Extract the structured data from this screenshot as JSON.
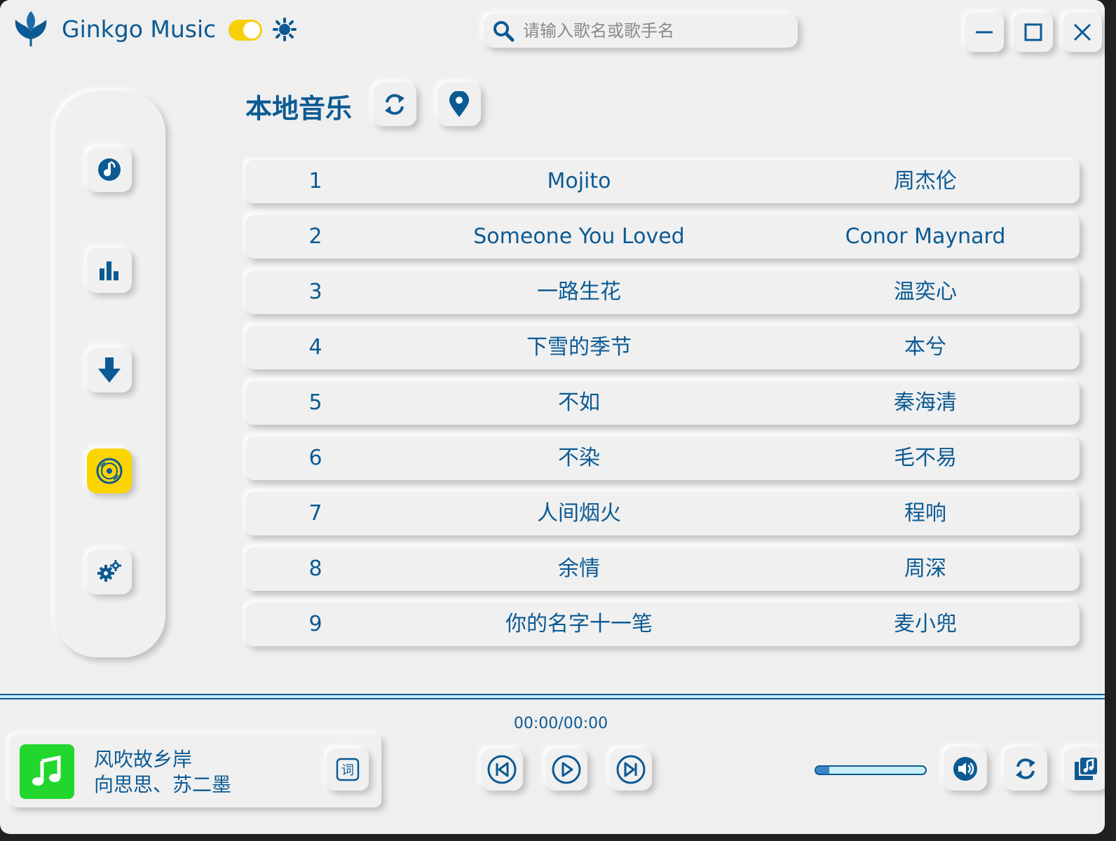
{
  "app": {
    "title": "Ginkgo Music"
  },
  "search": {
    "placeholder": "请输入歌名或歌手名"
  },
  "theme": {
    "toggle_on": true
  },
  "page": {
    "title": "本地音乐"
  },
  "songs": [
    {
      "index": "1",
      "title": "Mojito",
      "artist": "周杰伦"
    },
    {
      "index": "2",
      "title": "Someone You Loved",
      "artist": "Conor Maynard"
    },
    {
      "index": "3",
      "title": "一路生花",
      "artist": "温奕心"
    },
    {
      "index": "4",
      "title": "下雪的季节",
      "artist": "本兮"
    },
    {
      "index": "5",
      "title": "不如",
      "artist": "秦海清"
    },
    {
      "index": "6",
      "title": "不染",
      "artist": "毛不易"
    },
    {
      "index": "7",
      "title": "人间烟火",
      "artist": "程响"
    },
    {
      "index": "8",
      "title": "余情",
      "artist": "周深"
    },
    {
      "index": "9",
      "title": "你的名字十一笔",
      "artist": "麦小兜"
    }
  ],
  "player": {
    "song_title": "风吹故乡岸",
    "song_artist": "向思思、苏二墨",
    "time": "00:00/00:00",
    "lyric_label": "词",
    "volume": 0.12
  },
  "colors": {
    "accent": "#0c5a93",
    "highlight": "#fcd500",
    "cover": "#22d62e",
    "background": "#efefef"
  },
  "icons": {
    "sidebar": [
      "music-note-icon",
      "bar-chart-icon",
      "download-icon",
      "disc-icon",
      "gears-icon"
    ],
    "header": [
      "refresh-icon",
      "location-pin-icon"
    ],
    "controls": [
      "previous-icon",
      "play-icon",
      "next-icon"
    ],
    "right": [
      "volume-icon",
      "repeat-icon",
      "playlist-icon"
    ]
  }
}
